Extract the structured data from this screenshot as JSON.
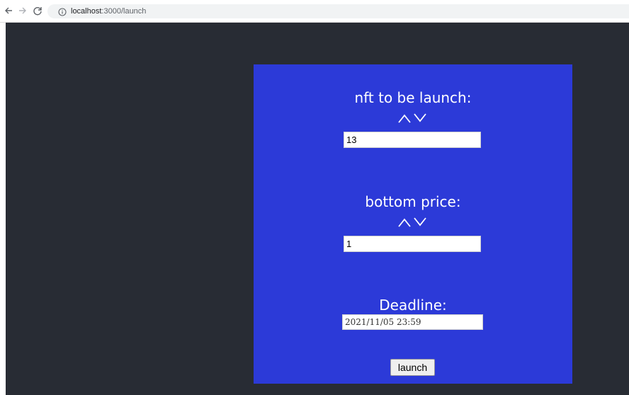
{
  "browser": {
    "url_host": "localhost",
    "url_path": ":3000/launch"
  },
  "form": {
    "nft_label": "nft to be launch:",
    "nft_value": "13",
    "price_label": "bottom price:",
    "price_value": "1",
    "deadline_label": "Deadline:",
    "deadline_value": "2021/11/05 23:59",
    "launch_label": "launch"
  },
  "colors": {
    "page_background": "#282c34",
    "panel_background": "#2c3ad8",
    "label_text": "#ffffff"
  },
  "icons": {
    "back": "arrow-left-icon",
    "forward": "arrow-right-icon",
    "reload": "reload-icon",
    "info": "info-icon",
    "stepper_up": "chevron-up-icon",
    "stepper_down": "chevron-down-icon"
  }
}
